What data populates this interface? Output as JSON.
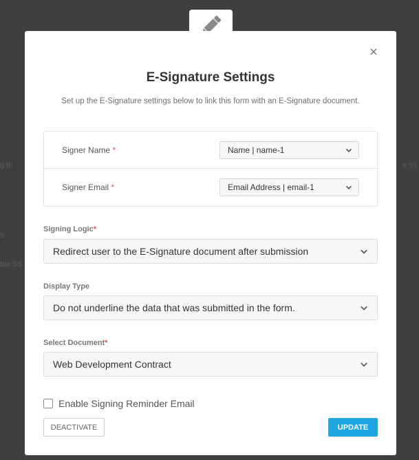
{
  "background": {
    "left_fragments": [
      "g th",
      "s",
      "ble SS"
    ],
    "right_fragment": "e mi"
  },
  "modal": {
    "title": "E-Signature Settings",
    "subtitle": "Set up the E-Signature settings below to link this form with an E-Signature document.",
    "close_glyph": "×",
    "icon": "pencil-icon"
  },
  "signer": {
    "name_label": "Signer Name",
    "name_value": "Name | name-1",
    "email_label": "Signer Email",
    "email_value": "Email Address | email-1",
    "required_mark": "*"
  },
  "signing_logic": {
    "label": "Signing Logic",
    "value": "Redirect user to the E-Signature document after submission"
  },
  "display_type": {
    "label": "Display Type",
    "value": "Do not underline the data that was submitted in the form."
  },
  "select_document": {
    "label": "Select Document",
    "value": "Web Development Contract"
  },
  "reminder": {
    "label": "Enable Signing Reminder Email",
    "checked": false
  },
  "buttons": {
    "deactivate": "DEACTIVATE",
    "update": "UPDATE"
  },
  "colors": {
    "accent": "#1ea7e1",
    "required": "#d9534f",
    "overlay": "#3f3f3f"
  }
}
